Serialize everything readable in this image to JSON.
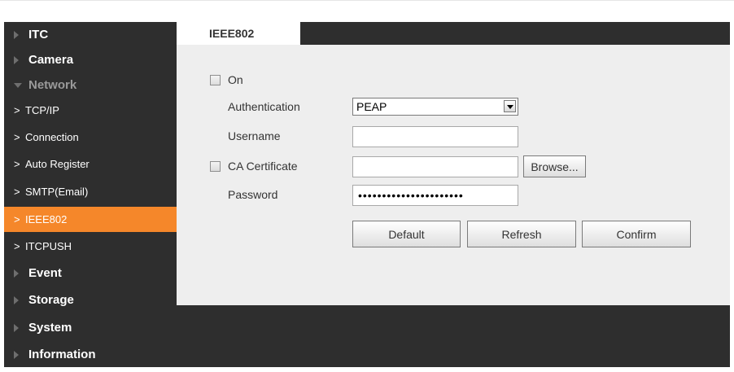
{
  "sidebar": {
    "items": [
      {
        "label": "ITC",
        "level": "top",
        "state": "collapsed"
      },
      {
        "label": "Camera",
        "level": "top",
        "state": "collapsed"
      },
      {
        "label": "Network",
        "level": "top",
        "state": "expanded"
      },
      {
        "label": "TCP/IP",
        "level": "sub",
        "chevron": ">"
      },
      {
        "label": "Connection",
        "level": "sub",
        "chevron": ">"
      },
      {
        "label": "Auto Register",
        "level": "sub",
        "chevron": ">"
      },
      {
        "label": "SMTP(Email)",
        "level": "sub",
        "chevron": ">"
      },
      {
        "label": "IEEE802",
        "level": "sub",
        "chevron": ">",
        "active": true
      },
      {
        "label": "ITCPUSH",
        "level": "sub",
        "chevron": ">"
      },
      {
        "label": "Event",
        "level": "top",
        "state": "collapsed"
      },
      {
        "label": "Storage",
        "level": "top",
        "state": "collapsed"
      },
      {
        "label": "System",
        "level": "top",
        "state": "collapsed"
      },
      {
        "label": "Information",
        "level": "top",
        "state": "collapsed"
      }
    ]
  },
  "tab": {
    "label": "IEEE802"
  },
  "form": {
    "on_label": "On",
    "on_checked": false,
    "authentication_label": "Authentication",
    "authentication_value": "PEAP",
    "username_label": "Username",
    "username_value": "",
    "ca_certificate_label": "CA Certificate",
    "ca_certificate_checked": false,
    "ca_certificate_value": "",
    "browse_label": "Browse...",
    "password_label": "Password",
    "password_value": "••••••••••••••••••••••"
  },
  "buttons": {
    "default_label": "Default",
    "refresh_label": "Refresh",
    "confirm_label": "Confirm"
  },
  "colors": {
    "sidebar_bg": "#2e2e2e",
    "active_item": "#f5872a",
    "content_bg": "#eeeeee"
  }
}
